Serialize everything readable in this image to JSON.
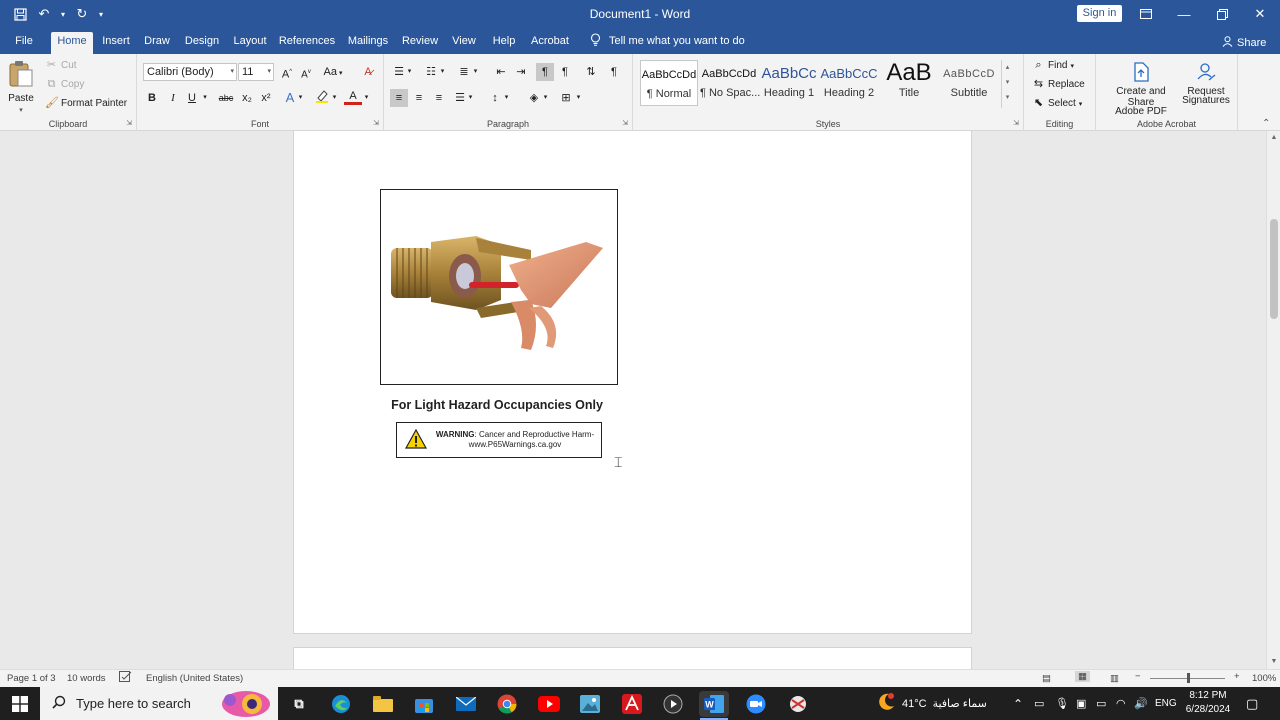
{
  "titlebar": {
    "title": "Document1  -  Word",
    "sign_in": "Sign in"
  },
  "tabs": [
    "File",
    "Home",
    "Insert",
    "Draw",
    "Design",
    "Layout",
    "References",
    "Mailings",
    "Review",
    "View",
    "Help",
    "Acrobat"
  ],
  "active_tab": "Home",
  "tell_me": "Tell me what you want to do",
  "share": "Share",
  "clipboard": {
    "paste": "Paste",
    "cut": "Cut",
    "copy": "Copy",
    "format_painter": "Format Painter",
    "label": "Clipboard"
  },
  "font": {
    "name": "Calibri (Body)",
    "size": "11",
    "label": "Font",
    "change_case": "Aa",
    "bold": "B",
    "italic": "I",
    "underline": "U",
    "strike": "abc",
    "sub": "x₂",
    "sup": "x²",
    "effects": "A",
    "font_color": "A"
  },
  "paragraph": {
    "label": "Paragraph"
  },
  "styles": {
    "label": "Styles",
    "items": [
      {
        "preview": "AaBbCcDd",
        "name": "¶ Normal"
      },
      {
        "preview": "AaBbCcDd",
        "name": "¶ No Spac..."
      },
      {
        "preview": "AaBbCc",
        "name": "Heading 1"
      },
      {
        "preview": "AaBbCcC",
        "name": "Heading 2"
      },
      {
        "preview": "AaB",
        "name": "Title"
      },
      {
        "preview": "AaBbCcD",
        "name": "Subtitle"
      }
    ]
  },
  "editing": {
    "label": "Editing",
    "find": "Find",
    "replace": "Replace",
    "select": "Select"
  },
  "acrobat": {
    "label": "Adobe Acrobat",
    "create_line1": "Create and Share",
    "create_line2": "Adobe PDF",
    "request_line1": "Request",
    "request_line2": "Signatures"
  },
  "document": {
    "caption": "For Light Hazard Occupancies Only",
    "warning_bold": "WARNING",
    "warning_text": ": Cancer and Reproductive Harm-",
    "warning_url": "www.P65Warnings.ca.gov"
  },
  "status": {
    "page": "Page 1 of 3",
    "words": "10 words",
    "language": "English (United States)",
    "zoom": "100%"
  },
  "taskbar": {
    "search_placeholder": "Type here to search",
    "temperature": "41°C",
    "weather": "سماء صافية",
    "language": "ENG",
    "time": "8:12 PM",
    "date": "6/28/2024"
  }
}
